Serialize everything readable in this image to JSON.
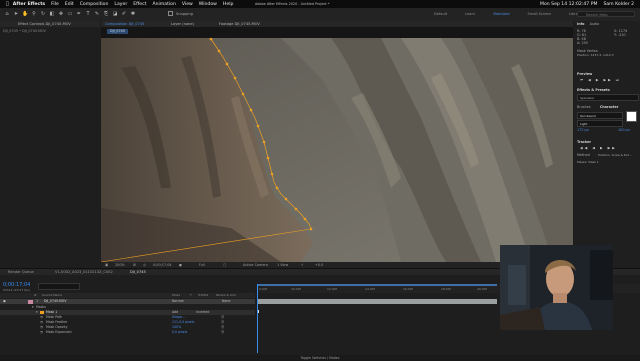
{
  "menubar": {
    "app_name": "After Effects",
    "items": [
      "File",
      "Edit",
      "Composition",
      "Layer",
      "Effect",
      "Animation",
      "View",
      "Window",
      "Help"
    ],
    "status_right": "Mon Sep 14  12:02:47 PM",
    "user": "Sam Kolder 2"
  },
  "toolbar": {
    "snapping_label": "Snapping",
    "window_title": "Adobe After Effects 2020 - Untitled Project *",
    "workspaces": [
      "Default",
      "Learn",
      "Standard",
      "Small Screen",
      "Libraries"
    ],
    "active_workspace": "Standard",
    "search_placeholder": "Search Help"
  },
  "left_panel": {
    "tab_label": "Effect Controls DJI_0745.MOV",
    "breadcrumb": "DJI_0745 • DJI_0745.MOV"
  },
  "viewer": {
    "tabs": [
      "Composition DJI_0745",
      "Layer (none)",
      "Footage DJI_0745.MOV"
    ],
    "comp_tab": "DJI_0745",
    "zoom": "200%",
    "timecode": "0;00;17;04",
    "resolution": "Full",
    "camera": "Active Camera",
    "views": "1 View",
    "exposure": "+0.0"
  },
  "right_panel": {
    "info_tab": "Info",
    "audio_tab": "Audio",
    "info_values": [
      "R: 76",
      "G: 61",
      "B: 48",
      "A: 255"
    ],
    "info_xy": [
      "X: 1174",
      "Y: -210"
    ],
    "mask_label": "Mask Vertex",
    "mask_pos": "Position: 1437.3, 1212.3",
    "preview_label": "Preview",
    "effects_label": "Effects & Presets",
    "effects_preset": "Spacebar",
    "brushes_label": "Brushes",
    "character_label": "Character",
    "font_name": "Quicksand",
    "font_style": "Light",
    "font_size": "172 px",
    "tracking": "Auto",
    "leading": "100 px",
    "tracker_label": "Tracker",
    "track_method": "Position, Scale & Rot...",
    "motion_label": "Method",
    "mask_target": "Masks: Mask 1",
    "swatch_white": "#ffffff"
  },
  "timeline": {
    "tabs": [
      "Render Queue",
      "V1-0002_A023_0110213Z_C002",
      "DJI_0745"
    ],
    "active_tab": "DJI_0745",
    "timecode": "0;00:17;04",
    "fps": "00514 (29.97 fps)",
    "columns": [
      "#",
      "Source Name",
      "Mode",
      "T",
      "TrkMat",
      "Parent & Link"
    ],
    "layer": {
      "index": "1",
      "name": "DJI_0745.MOV",
      "mode": "Normal",
      "parent": "None"
    },
    "masks_group": "Masks",
    "mask_name": "Mask 1",
    "mask_mode": "Add",
    "inverted": "Inverted",
    "mask_props": [
      {
        "name": "Mask Path",
        "value": "Shape..."
      },
      {
        "name": "Mask Feather",
        "value": "111,0,0 pixels"
      },
      {
        "name": "Mask Opacity",
        "value": "100%"
      },
      {
        "name": "Mask Expansion",
        "value": "0,0 pixels"
      }
    ],
    "ruler_labels": [
      "0:00f",
      "10:00f",
      "12:00f",
      "14:00f",
      "16:00f",
      "18:00f",
      "20:00f",
      "22:00f"
    ],
    "footer": "Toggle Switches / Modes"
  },
  "colors": {
    "accent_blue": "#3b8cf0",
    "mask_orange": "#f0a020",
    "layer_pink": "#c98aa3"
  }
}
